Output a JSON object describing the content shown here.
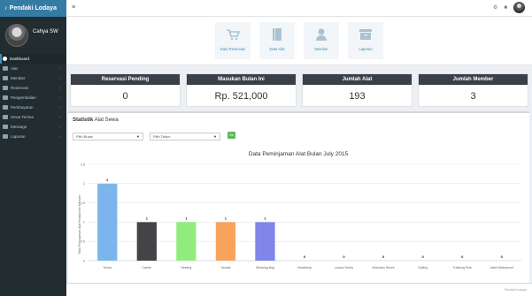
{
  "app": {
    "title": "Pendaki Lodaya"
  },
  "user": {
    "name": "Cahya SW"
  },
  "sidebar": {
    "items": [
      {
        "label": "Dashboard",
        "active": true
      },
      {
        "label": "Alat"
      },
      {
        "label": "Member"
      },
      {
        "label": "Reservasi"
      },
      {
        "label": "Pengembalian"
      },
      {
        "label": "Pembayaran"
      },
      {
        "label": "Sewa Terima"
      },
      {
        "label": "Message"
      },
      {
        "label": "Laporan"
      }
    ]
  },
  "quick_links": [
    {
      "label": "Data Reservasi",
      "icon": "cart-icon"
    },
    {
      "label": "Data Alat",
      "icon": "book-icon"
    },
    {
      "label": "Member",
      "icon": "user-icon"
    },
    {
      "label": "Laporan",
      "icon": "archive-icon"
    }
  ],
  "stats": [
    {
      "title": "Reservasi Pending",
      "value": "0"
    },
    {
      "title": "Masukan Bulan Ini",
      "value": "Rp. 521,000"
    },
    {
      "title": "Jumlah Alat",
      "value": "193"
    },
    {
      "title": "Jumlah Member",
      "value": "3"
    }
  ],
  "chart_box": {
    "title_bold": "Statistik",
    "title_rest": " Alat Sewa",
    "select_month": "Pilih Bulan",
    "select_year": "Pilih Tahun",
    "go_label": "Go"
  },
  "footer": {
    "text": "Pendaki Lodaya"
  },
  "chart_data": {
    "type": "bar",
    "title": "Data Peminjaman Alat Bulan July 2015",
    "ylabel": "Total Peminjaman Alat Pendaki Ke Member",
    "xlabel": "",
    "ylim": [
      0,
      2.5
    ],
    "yticks": [
      0,
      0.5,
      1,
      1.5,
      2,
      2.5
    ],
    "categories": [
      "Tenda",
      "Carrier",
      "Nesting",
      "Sandal",
      "Sleeping Bag",
      "Headlamp",
      "Lampu Tenda",
      "Mountain Shoes",
      "Gaiting",
      "Trekking Pole",
      "Jaket Waterproof"
    ],
    "values": [
      2,
      1,
      1,
      1,
      1,
      0,
      0,
      0,
      0,
      0,
      0
    ],
    "colors": [
      "#7cb5ec",
      "#434348",
      "#90ed7d",
      "#f7a35c",
      "#8085e9",
      "#f15c80",
      "#e4d354",
      "#2b908f",
      "#f45b5b",
      "#91e8e1",
      "#7cb5ec"
    ]
  }
}
